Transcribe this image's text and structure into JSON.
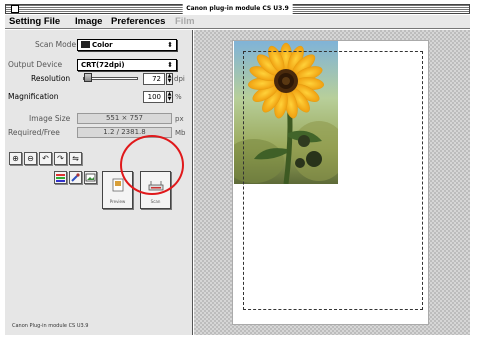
{
  "window": {
    "title": "Canon plug-in module CS U3.9"
  },
  "menubar": {
    "items": [
      "Setting File",
      "Image",
      "Preferences",
      "Film"
    ]
  },
  "controls": {
    "scan_mode": {
      "label": "Scan Mode",
      "value": "Color"
    },
    "output_device": {
      "label": "Output Device",
      "value": "CRT(72dpi)"
    },
    "resolution": {
      "label": "Resolution",
      "value": "72",
      "unit": "dpi",
      "level": 0.03
    },
    "magnification": {
      "label": "Magnification",
      "value": "100",
      "unit": "%"
    },
    "image_size": {
      "label": "Image Size",
      "value": "551 × 757",
      "unit": "px"
    },
    "required_free": {
      "label": "Required/Free",
      "value": "1.2 / 2381.8",
      "unit": "Mb"
    }
  },
  "tools": [
    "zoom-in",
    "zoom-out",
    "rotate-left",
    "rotate-right",
    "flip",
    "color-settings",
    "eyedropper",
    "image-adjust"
  ],
  "buttons": {
    "preview": "Preview",
    "scan": "Scan"
  },
  "status": {
    "text": "Canon Plug-in module CS U3.9"
  },
  "colors": {
    "callout": "#e0191b"
  }
}
